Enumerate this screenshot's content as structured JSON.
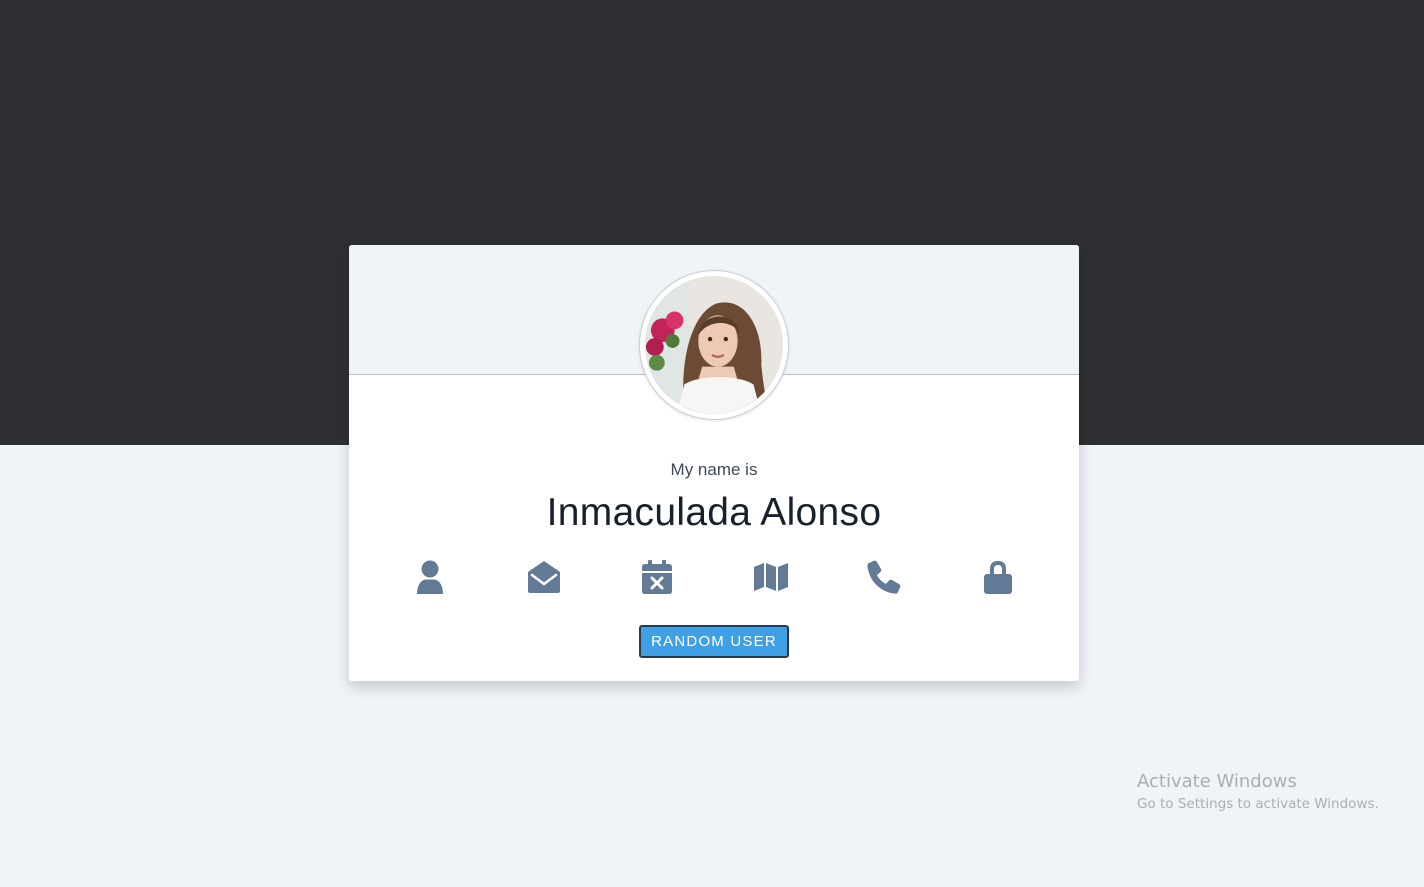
{
  "card": {
    "title_label": "My name is",
    "value_label": "Inmaculada Alonso",
    "avatar_alt": "user photo",
    "icons": [
      {
        "name": "user-icon",
        "active": true
      },
      {
        "name": "envelope-open-icon",
        "active": false
      },
      {
        "name": "calendar-x-icon",
        "active": false
      },
      {
        "name": "map-icon",
        "active": false
      },
      {
        "name": "phone-icon",
        "active": false
      },
      {
        "name": "lock-icon",
        "active": false
      }
    ],
    "button_label": "RANDOM USER"
  },
  "colors": {
    "dark_band": "#2d2f33",
    "light_bg": "#f0f4f7",
    "icon": "#627a96",
    "button": "#3fa0e6"
  },
  "watermark": {
    "title": "Activate Windows",
    "subtitle": "Go to Settings to activate Windows."
  }
}
